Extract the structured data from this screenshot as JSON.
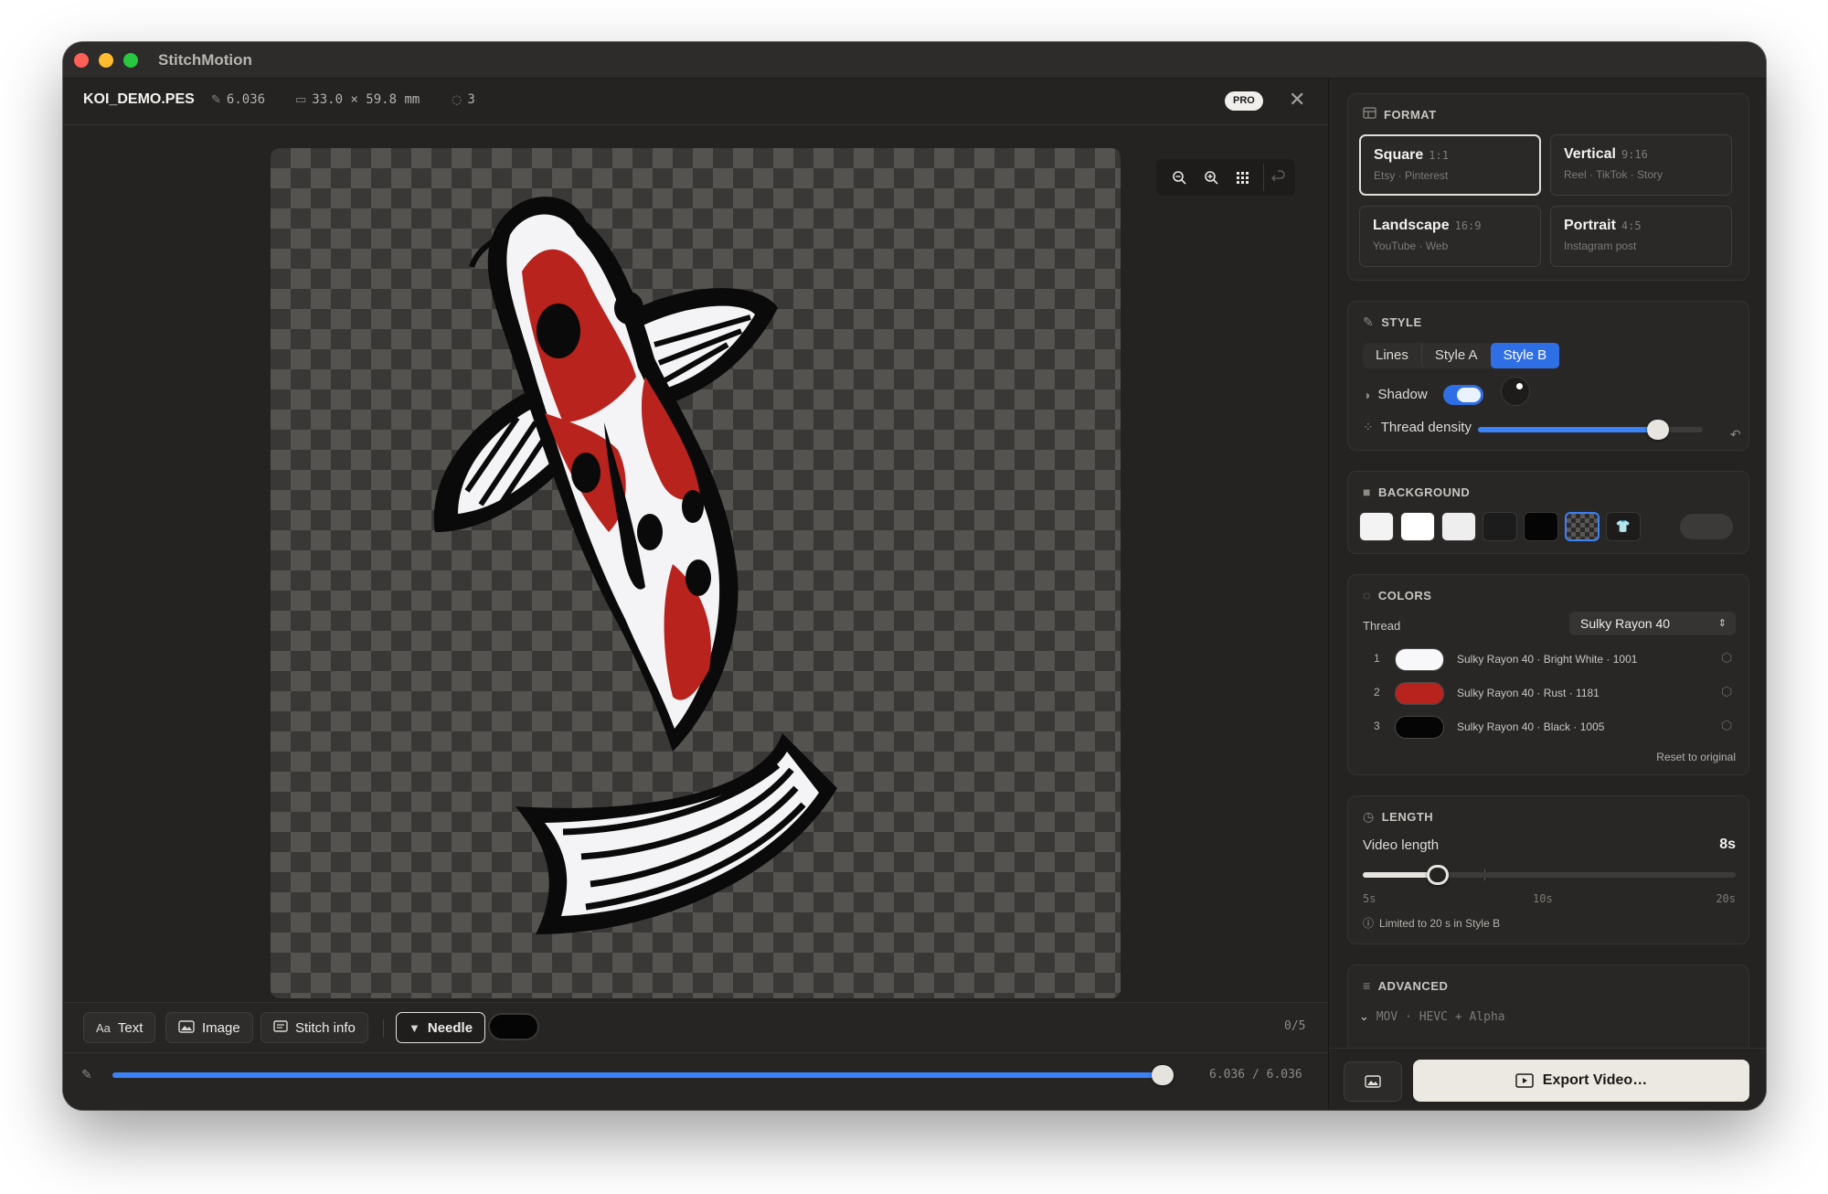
{
  "window": {
    "title": "StitchMotion"
  },
  "file": {
    "name": "KOI_DEMO.PES",
    "stitches": "6.036",
    "dimensions": "33.0 × 59.8 mm",
    "colors": "3",
    "badge": "PRO"
  },
  "toolbar": {
    "text_label": "Text",
    "text_icon": "Aa",
    "image_label": "Image",
    "stitch_info_label": "Stitch info",
    "needle_label": "Needle",
    "needle_color": "#000000",
    "counter": "0/5",
    "progress_fraction": 1.0,
    "progress_text": "6.036 / 6.036"
  },
  "format": {
    "heading": "FORMAT",
    "options": [
      {
        "name": "Square",
        "ratio": "1:1",
        "sub": "Etsy · Pinterest",
        "selected": true
      },
      {
        "name": "Vertical",
        "ratio": "9:16",
        "sub": "Reel · TikTok · Story",
        "selected": false
      },
      {
        "name": "Landscape",
        "ratio": "16:9",
        "sub": "YouTube · Web",
        "selected": false
      },
      {
        "name": "Portrait",
        "ratio": "4:5",
        "sub": "Instagram post",
        "selected": false
      }
    ]
  },
  "style": {
    "heading": "STYLE",
    "modes": [
      "Lines",
      "Style A",
      "Style B"
    ],
    "active_mode": "Style B",
    "shadow_label": "Shadow",
    "shadow_on": true,
    "density_label": "Thread density",
    "density_fraction": 0.8
  },
  "background": {
    "heading": "BACKGROUND",
    "swatches": [
      "#f3f3f3",
      "#ffffff",
      "#eeeeee",
      "#1c1c1c",
      "#050505",
      "transparent",
      "shirt"
    ],
    "selected": "transparent"
  },
  "colors": {
    "heading": "COLORS",
    "thread_label": "Thread",
    "thread_brand": "Sulky Rayon 40",
    "items": [
      {
        "index": "1",
        "color": "#f8f8fa",
        "name": "Sulky Rayon 40 · Bright White · 1001"
      },
      {
        "index": "2",
        "color": "#b8231d",
        "name": "Sulky Rayon 40 · Rust · 1181"
      },
      {
        "index": "3",
        "color": "#050505",
        "name": "Sulky Rayon 40 · Black · 1005"
      }
    ],
    "reset_label": "Reset to original"
  },
  "length": {
    "heading": "LENGTH",
    "label": "Video length",
    "value": "8s",
    "seconds": 8,
    "min": 5,
    "max": 20,
    "ticks": [
      "5s",
      "10s",
      "20s"
    ],
    "note": "Limited to 20 s in Style B"
  },
  "advanced": {
    "heading": "ADVANCED",
    "summary": "MOV · HEVC + Alpha"
  },
  "footer": {
    "export_label": "Export Video…"
  },
  "colors_theme": {
    "accent": "#3b82f6",
    "fish_red": "#b8231d",
    "fish_white": "#f4f4f6",
    "fish_black": "#0a0a0a"
  }
}
